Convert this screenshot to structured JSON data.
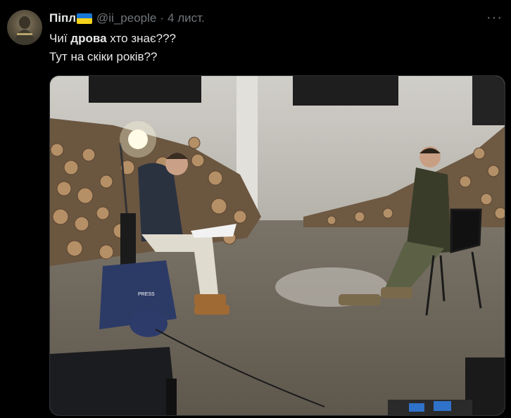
{
  "tweet": {
    "author_name": "Піпл",
    "author_handle": "@ii_people",
    "separator": "·",
    "timestamp": "4 лист.",
    "more_glyph": "···",
    "text_line1_before": "Чиї ",
    "text_line1_bold": "дрова",
    "text_line1_after": " хто знає???",
    "text_line2": "Тут на скіки років??"
  },
  "media": {
    "vest_label": "PRESS"
  },
  "colors": {
    "background": "#000000",
    "text_primary": "#e7e9ea",
    "text_secondary": "#71767b",
    "flag_blue": "#1877d6",
    "flag_yellow": "#f7d21c"
  },
  "icons": {
    "flag": "ukraine-flag-icon",
    "more": "more-options-icon"
  }
}
